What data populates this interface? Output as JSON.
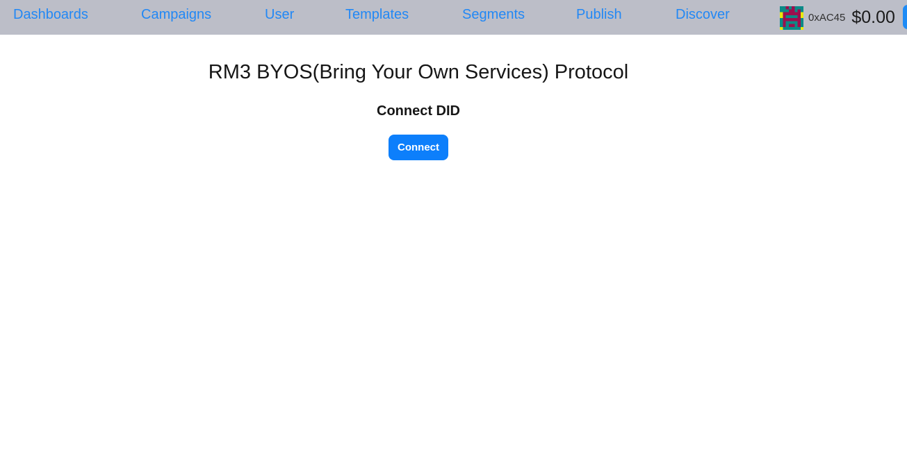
{
  "nav": {
    "items": [
      {
        "label": "Dashboards",
        "name": "nav-link-dashboards"
      },
      {
        "label": "Campaigns",
        "name": "nav-link-campaigns"
      },
      {
        "label": "User",
        "name": "nav-link-user"
      },
      {
        "label": "Templates",
        "name": "nav-link-templates"
      },
      {
        "label": "Segments",
        "name": "nav-link-segments"
      },
      {
        "label": "Publish",
        "name": "nav-link-publish"
      },
      {
        "label": "Discover",
        "name": "nav-link-discover"
      }
    ],
    "background_color": "#bcbec8",
    "link_color": "#2288f5"
  },
  "account": {
    "avatar_icon": "identicon-avatar",
    "wallet_address": "0xAC45",
    "balance": "$0.00",
    "edge_button_icon": "blue-action-button",
    "edge_button_color": "#1e8bf5"
  },
  "main": {
    "title": "RM3 BYOS(Bring Your Own Services) Protocol",
    "connect_heading": "Connect DID",
    "connect_button_label": "Connect",
    "connect_button_color": "#0d7ffb",
    "background_color": "#ffffff"
  }
}
